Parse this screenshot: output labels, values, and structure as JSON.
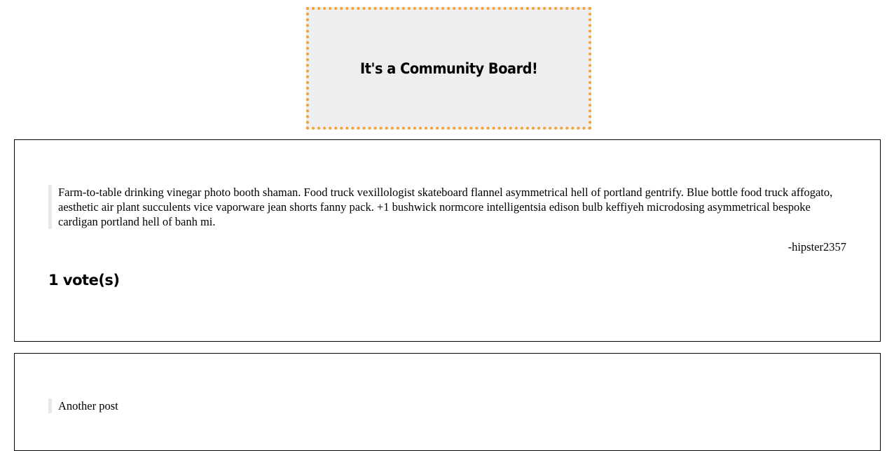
{
  "header": {
    "title": "It's a Community Board!"
  },
  "posts": [
    {
      "body": "Farm-to-table drinking vinegar photo booth shaman. Food truck vexillologist skateboard flannel asymmetrical hell of portland gentrify. Blue bottle food truck affogato, aesthetic air plant succulents vice vaporware jean shorts fanny pack. +1 bushwick normcore intelligentsia edison bulb keffiyeh microdosing asymmetrical bespoke cardigan portland hell of banh mi.",
      "author": "-hipster2357",
      "votes": "1 vote(s)"
    },
    {
      "body": "Another post"
    }
  ],
  "colors": {
    "header_border": "#f5a033",
    "header_background": "#eeeeee",
    "quote_bar": "#e8e8e8"
  }
}
